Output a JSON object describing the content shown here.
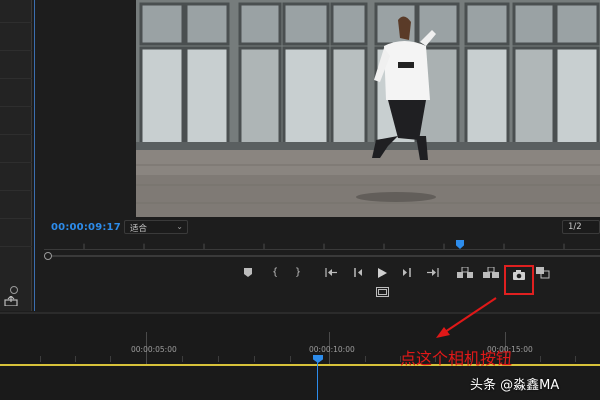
{
  "monitor": {
    "timecode": "00:00:09:17",
    "fit_label": "适合",
    "resolution": "1/2"
  },
  "controls": {
    "icons": [
      "add-marker-icon",
      "mark-in-icon",
      "mark-out-icon",
      "go-to-in-icon",
      "step-back-icon",
      "play-icon",
      "step-forward-icon",
      "go-to-out-icon",
      "lift-icon",
      "extract-icon",
      "export-frame-icon",
      "comparison-view-icon",
      "safe-margins-icon"
    ]
  },
  "timeline": {
    "ticks": [
      {
        "label": "00:00:05:00"
      },
      {
        "label": "00:00:10:00"
      },
      {
        "label": "00:00:15:00"
      }
    ]
  },
  "annotation": {
    "text": "点这个相机按钮",
    "color": "#e01818"
  },
  "watermark": {
    "text": "头条 @淼鑫MA"
  },
  "colors": {
    "accent": "#2d8ceb",
    "timeline_line": "#d7c23a",
    "highlight": "#e02020"
  }
}
